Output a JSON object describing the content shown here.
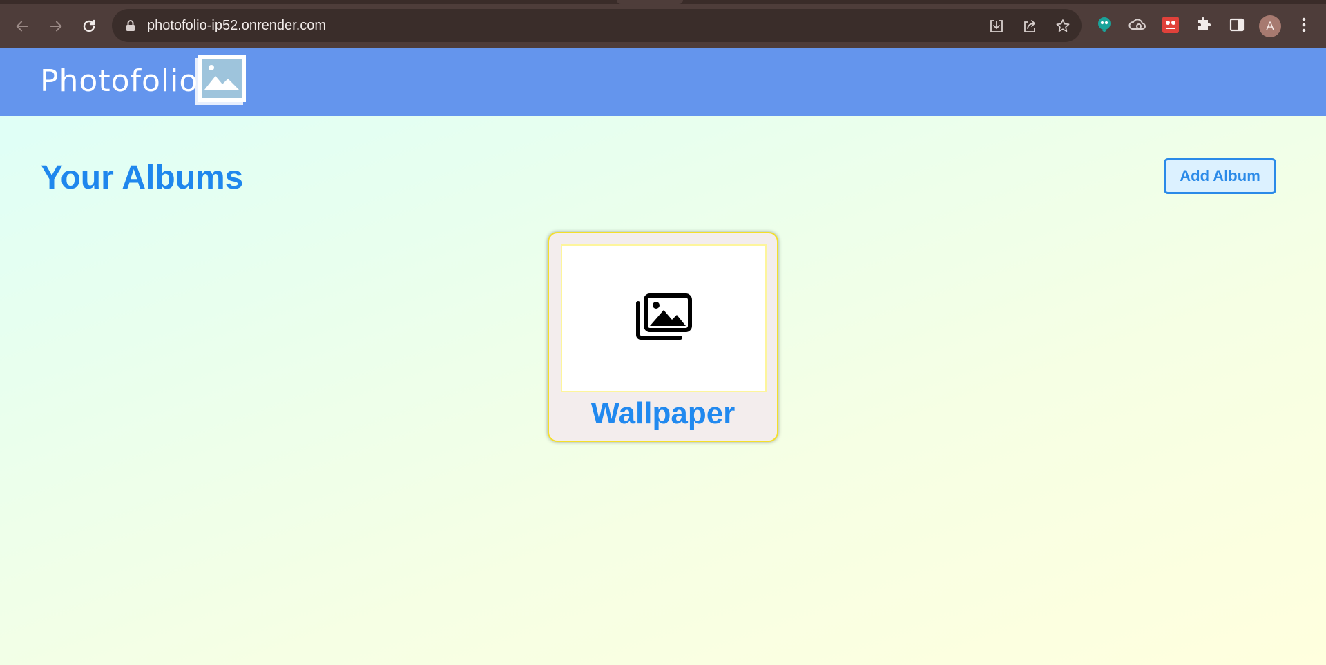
{
  "browser": {
    "url": "photofolio-ip52.onrender.com",
    "profile_initial": "A",
    "nav_icons": [
      "back-arrow-icon",
      "forward-arrow-icon",
      "reload-icon"
    ],
    "omnibox_icons": [
      "install-app-icon",
      "share-icon",
      "bookmark-star-icon"
    ],
    "extension_icons": [
      "green-extension-icon",
      "cloud-extension-icon",
      "red-extension-icon",
      "puzzle-extensions-icon",
      "side-panel-icon"
    ],
    "menu_icon": "three-dot-menu-icon"
  },
  "app": {
    "brand": "Photofolio",
    "logo_icon": "photo-frame-logo-icon",
    "colors": {
      "navbar": "#6495ed",
      "accent": "#1f87ed",
      "card_border": "#f4df2a"
    }
  },
  "main": {
    "heading": "Your Albums",
    "add_album_label": "Add Album",
    "albums": [
      {
        "name": "Wallpaper",
        "icon": "photo-album-icon"
      }
    ]
  }
}
